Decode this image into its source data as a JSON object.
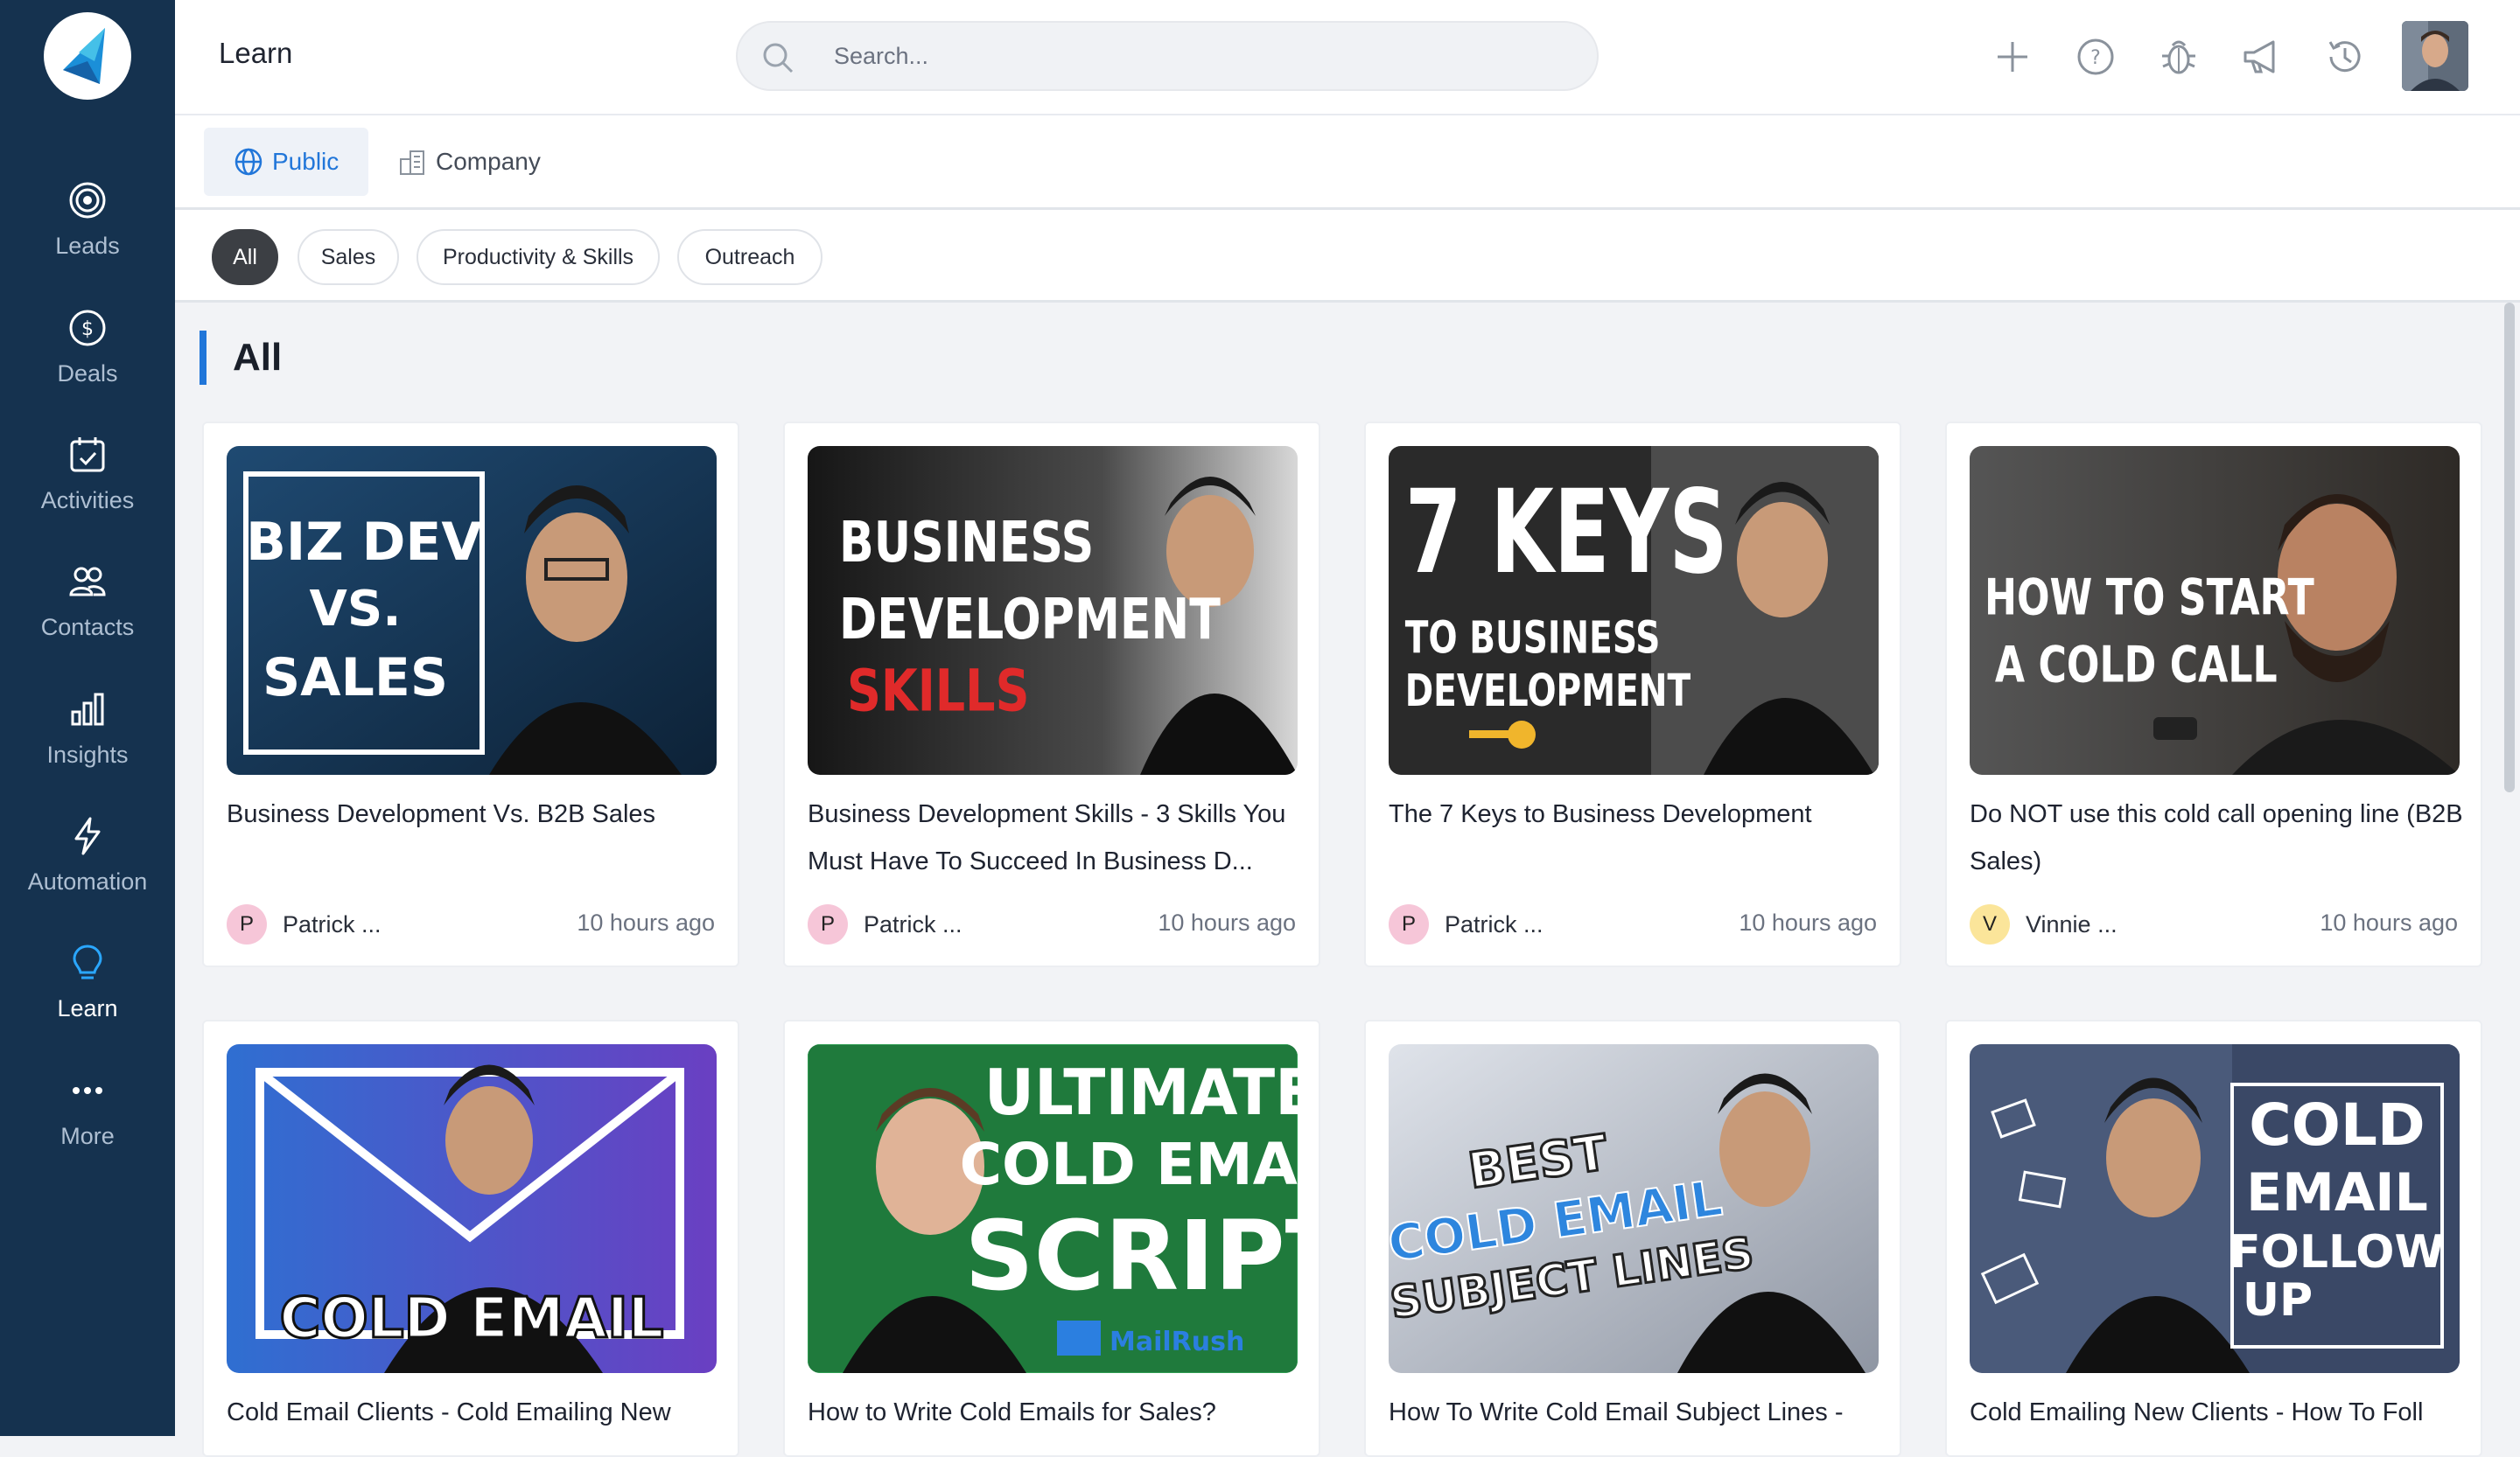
{
  "app": {
    "page_title": "Learn"
  },
  "sidebar": {
    "items": [
      {
        "label": "Leads",
        "icon": "target-icon"
      },
      {
        "label": "Deals",
        "icon": "dollar-icon"
      },
      {
        "label": "Activities",
        "icon": "calendar-check-icon"
      },
      {
        "label": "Contacts",
        "icon": "users-icon"
      },
      {
        "label": "Insights",
        "icon": "bar-chart-icon"
      },
      {
        "label": "Automation",
        "icon": "bolt-icon"
      },
      {
        "label": "Learn",
        "icon": "lightbulb-icon",
        "active": true
      },
      {
        "label": "More",
        "icon": "more-dots-icon"
      }
    ]
  },
  "search": {
    "placeholder": "Search..."
  },
  "topbar": {
    "icons": [
      "plus-icon",
      "help-icon",
      "bug-icon",
      "megaphone-icon",
      "history-icon",
      "user-avatar"
    ]
  },
  "scope_tabs": [
    {
      "label": "Public",
      "icon": "globe-icon",
      "active": true
    },
    {
      "label": "Company",
      "icon": "building-icon",
      "active": false
    }
  ],
  "filters": [
    {
      "label": "All",
      "active": true
    },
    {
      "label": "Sales",
      "active": false
    },
    {
      "label": "Productivity & Skills",
      "active": false
    },
    {
      "label": "Outreach",
      "active": false
    }
  ],
  "section": {
    "title": "All"
  },
  "cards": [
    {
      "title": "Business Development Vs. B2B Sales",
      "author": "Patrick ...",
      "initial": "P",
      "time": "10 hours ago",
      "thumb_text": [
        "BIZ DEV",
        "VS.",
        "SALES"
      ]
    },
    {
      "title": "Business Development Skills - 3 Skills You Must Have To Succeed In Business D...",
      "author": "Patrick ...",
      "initial": "P",
      "time": "10 hours ago",
      "thumb_text": [
        "BUSINESS",
        "DEVELOPMENT",
        "SKILLS"
      ]
    },
    {
      "title": "The 7 Keys to Business Development",
      "author": "Patrick ...",
      "initial": "P",
      "time": "10 hours ago",
      "thumb_text": [
        "7 KEYS",
        "TO BUSINESS",
        "DEVELOPMENT"
      ]
    },
    {
      "title": "Do NOT use this cold call opening line (B2B Sales)",
      "author": "Vinnie ...",
      "initial": "V",
      "time": "10 hours ago",
      "thumb_text": [
        "HOW TO START",
        "A COLD CALL"
      ]
    },
    {
      "title": "Cold Email Clients - Cold Emailing New",
      "thumb_text": [
        "COLD EMAIL"
      ]
    },
    {
      "title": "How to Write Cold Emails for Sales?",
      "thumb_text": [
        "ULTIMATE",
        "COLD EMAIL",
        "SCRIPT",
        "MailRush"
      ]
    },
    {
      "title": "How To Write Cold Email Subject Lines -",
      "thumb_text": [
        "BEST",
        "COLD EMAIL",
        "SUBJECT LINES"
      ]
    },
    {
      "title": "Cold Emailing New Clients - How To Foll",
      "thumb_text": [
        "COLD",
        "EMAIL",
        "FOLLOW",
        "UP"
      ]
    }
  ],
  "colors": {
    "sidebar": "#15324f",
    "accent": "#2176d9",
    "chip_active": "#3c3f44",
    "badge_p": "#f6c6d8",
    "badge_v": "#fbe59a"
  }
}
